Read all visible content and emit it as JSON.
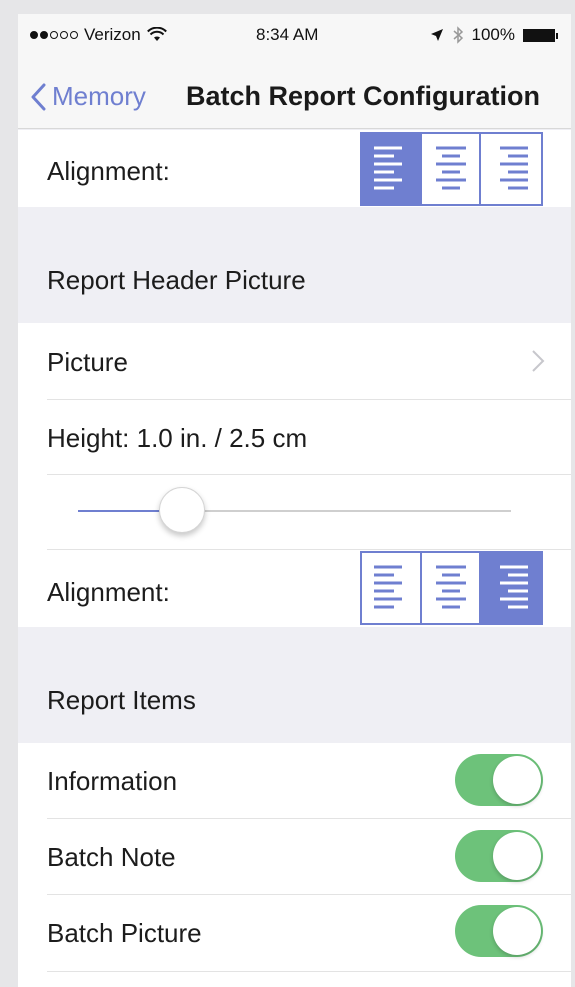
{
  "status_bar": {
    "signal_dots_filled": 2,
    "signal_dots_total": 5,
    "carrier": "Verizon",
    "wifi_icon": "wifi-icon",
    "time": "8:34 AM",
    "location_icon": "location-arrow-icon",
    "bluetooth_icon": "bluetooth-icon",
    "battery": "100%"
  },
  "nav": {
    "back_label": "Memory",
    "title": "Batch Report Configuration"
  },
  "top_section": {
    "alignment_label": "Alignment:",
    "alignment_options": [
      "left",
      "center",
      "right"
    ],
    "alignment_selected": "left"
  },
  "header_picture_section": {
    "header": "Report Header Picture",
    "picture_label": "Picture",
    "height_label": "Height: 1.0 in. / 2.5 cm",
    "slider_value": 0.24,
    "alignment_label": "Alignment:",
    "alignment_options": [
      "left",
      "center",
      "right"
    ],
    "alignment_selected": "right"
  },
  "report_items_section": {
    "header": "Report Items",
    "items": [
      {
        "label": "Information",
        "on": true
      },
      {
        "label": "Batch Note",
        "on": true
      },
      {
        "label": "Batch Picture",
        "on": true
      }
    ]
  },
  "colors": {
    "accent": "#6f7fd0",
    "toggle_on": "#6dc27a"
  }
}
